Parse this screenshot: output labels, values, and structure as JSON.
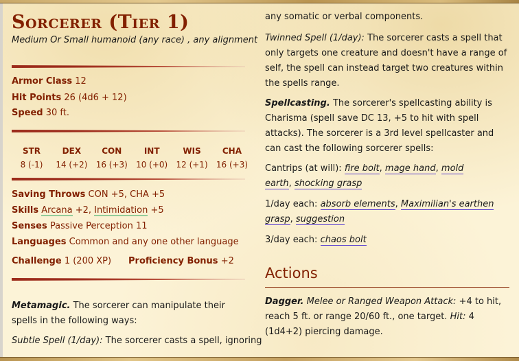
{
  "monster": {
    "name": "Sorcerer (Tier 1)",
    "meta": "Medium Or Small humanoid (any race) , any alignment"
  },
  "defense": {
    "armor_class_label": "Armor Class",
    "armor_class_value": "12",
    "hit_points_label": "Hit Points",
    "hit_points_value": "26 (4d6 + 12)",
    "speed_label": "Speed",
    "speed_value": "30 ft."
  },
  "abilities": [
    {
      "name": "STR",
      "value": "8 (-1)"
    },
    {
      "name": "DEX",
      "value": "14 (+2)"
    },
    {
      "name": "CON",
      "value": "16 (+3)"
    },
    {
      "name": "INT",
      "value": "10 (+0)"
    },
    {
      "name": "WIS",
      "value": "12 (+1)"
    },
    {
      "name": "CHA",
      "value": "16 (+3)"
    }
  ],
  "details": {
    "saving_throws_label": "Saving Throws",
    "saving_throws_value": "CON +5, CHA +5",
    "skills_label": "Skills",
    "skills": [
      {
        "name": "Arcana",
        "bonus": "+2"
      },
      {
        "name": "Intimidation",
        "bonus": "+5"
      }
    ],
    "senses_label": "Senses",
    "senses_value": "Passive Perception 11",
    "languages_label": "Languages",
    "languages_value": "Common and any one other language",
    "challenge_label": "Challenge",
    "challenge_value": "1 (200 XP)",
    "proficiency_label": "Proficiency Bonus",
    "proficiency_value": "+2"
  },
  "traits": {
    "metamagic_name": "Metamagic.",
    "metamagic_text": "The sorcerer can manipulate their spells in the following ways:",
    "subtle_name": "Subtle Spell (1/day):",
    "subtle_text_a": "The sorcerer casts a spell, ignoring",
    "subtle_text_b": "any somatic or verbal components.",
    "twinned_name": "Twinned Spell (1/day):",
    "twinned_text": "The sorcerer casts a spell that only targets one creature and doesn't have a range of self, the spell can instead target two creatures within the spells range.",
    "spellcasting_name": "Spellcasting.",
    "spellcasting_text": "The sorcerer's spellcasting ability is Charisma (spell save DC 13, +5 to hit with spell attacks). The sorcerer is a 3rd level spellcaster and can cast the following sorcerer spells:",
    "cantrips_label": "Cantrips (at will):",
    "cantrips": [
      "fire bolt",
      "mage hand",
      "mold earth",
      "shocking grasp"
    ],
    "oneday_label": "1/day each:",
    "oneday": [
      "absorb elements",
      "Maximilian's earthen grasp",
      "suggestion"
    ],
    "threeday_label": "3/day each:",
    "threeday": [
      "chaos bolt"
    ]
  },
  "actions": {
    "heading": "Actions",
    "dagger_name": "Dagger.",
    "dagger_attack_type": "Melee or Ranged Weapon Attack:",
    "dagger_text_a": "+4 to hit, reach 5 ft. or range 20/60 ft., one target.",
    "dagger_hit_label": "Hit:",
    "dagger_text_b": "4 (1d4+2) piercing damage."
  },
  "separators": {
    "comma": ",",
    "space": " "
  }
}
